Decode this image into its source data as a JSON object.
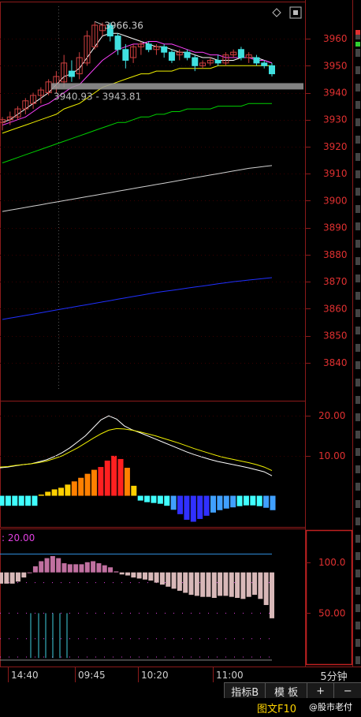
{
  "colors": {
    "background": "#000000",
    "frame": "#8b1a1a",
    "axis_text": "#e03030",
    "up_candle": "#d04040",
    "down_candle": "#40e0e0",
    "ma5": "#ffffff",
    "ma10": "#ff40ff",
    "ma20": "#f0f000",
    "ma30": "#00d000",
    "ma60": "#d0d0d0",
    "ma120": "#2030ff",
    "macd_dif": "#ffffff",
    "macd_dea": "#f0f000",
    "macd_hist_pos": [
      "#ff2020",
      "#ff8000",
      "#ffd000"
    ],
    "macd_hist_neg": [
      "#3030ff",
      "#40a0ff",
      "#40ffff"
    ],
    "osc_bar": "#d8b8b8",
    "osc_bar_up": "#c070a0",
    "osc_ref_line": "#3090e0",
    "osc_spike": "#40d0e0",
    "zone_band": "#999999"
  },
  "chart_data": [
    {
      "panel": "main",
      "type": "candlestick",
      "ylim": [
        3830,
        3972
      ],
      "y_ticks": [
        "3960",
        "3950",
        "3940",
        "3930",
        "3920",
        "3910",
        "3900",
        "3890",
        "3880",
        "3870",
        "3860",
        "3850",
        "3840"
      ],
      "high_label": "3966.36",
      "zone_label": "3940.93 - 3943.81",
      "zone": [
        3940.93,
        3943.81
      ],
      "candles": [
        {
          "o": 3929,
          "h": 3931,
          "l": 3926,
          "c": 3930
        },
        {
          "o": 3930,
          "h": 3933,
          "l": 3928,
          "c": 3931
        },
        {
          "o": 3931,
          "h": 3935,
          "l": 3930,
          "c": 3934
        },
        {
          "o": 3934,
          "h": 3938,
          "l": 3932,
          "c": 3937
        },
        {
          "o": 3936,
          "h": 3940,
          "l": 3934,
          "c": 3939
        },
        {
          "o": 3939,
          "h": 3942,
          "l": 3936,
          "c": 3941
        },
        {
          "o": 3940,
          "h": 3945,
          "l": 3939,
          "c": 3944
        },
        {
          "o": 3942,
          "h": 3948,
          "l": 3940,
          "c": 3946
        },
        {
          "o": 3944,
          "h": 3954,
          "l": 3942,
          "c": 3951
        },
        {
          "o": 3948,
          "h": 3952,
          "l": 3944,
          "c": 3946
        },
        {
          "o": 3947,
          "h": 3955,
          "l": 3945,
          "c": 3953
        },
        {
          "o": 3951,
          "h": 3963,
          "l": 3950,
          "c": 3961
        },
        {
          "o": 3957,
          "h": 3966.36,
          "l": 3956,
          "c": 3965
        },
        {
          "o": 3963,
          "h": 3966,
          "l": 3961,
          "c": 3965
        },
        {
          "o": 3965,
          "h": 3966,
          "l": 3959,
          "c": 3961
        },
        {
          "o": 3961,
          "h": 3962,
          "l": 3954,
          "c": 3956
        },
        {
          "o": 3956,
          "h": 3958,
          "l": 3949,
          "c": 3952
        },
        {
          "o": 3953,
          "h": 3958,
          "l": 3951,
          "c": 3957
        },
        {
          "o": 3957,
          "h": 3959,
          "l": 3954,
          "c": 3958
        },
        {
          "o": 3958,
          "h": 3959,
          "l": 3955,
          "c": 3956
        },
        {
          "o": 3956,
          "h": 3958,
          "l": 3954,
          "c": 3957
        },
        {
          "o": 3957,
          "h": 3958,
          "l": 3953,
          "c": 3955
        },
        {
          "o": 3955,
          "h": 3956,
          "l": 3951,
          "c": 3952
        },
        {
          "o": 3954,
          "h": 3956,
          "l": 3952,
          "c": 3955
        },
        {
          "o": 3955,
          "h": 3956,
          "l": 3952,
          "c": 3953
        },
        {
          "o": 3953,
          "h": 3954,
          "l": 3948,
          "c": 3950
        },
        {
          "o": 3950,
          "h": 3952,
          "l": 3949,
          "c": 3951
        },
        {
          "o": 3951,
          "h": 3953,
          "l": 3950,
          "c": 3952
        },
        {
          "o": 3952,
          "h": 3954,
          "l": 3950,
          "c": 3951
        },
        {
          "o": 3951,
          "h": 3955,
          "l": 3950,
          "c": 3954
        },
        {
          "o": 3954,
          "h": 3956,
          "l": 3953,
          "c": 3955
        },
        {
          "o": 3956,
          "h": 3957,
          "l": 3952,
          "c": 3953
        },
        {
          "o": 3953,
          "h": 3955,
          "l": 3951,
          "c": 3954
        },
        {
          "o": 3953,
          "h": 3954,
          "l": 3950,
          "c": 3951
        },
        {
          "o": 3951,
          "h": 3952,
          "l": 3949,
          "c": 3950
        },
        {
          "o": 3950,
          "h": 3951,
          "l": 3946,
          "c": 3947
        }
      ],
      "series": [
        {
          "key": "ma5",
          "values": [
            3929,
            3930,
            3932,
            3934,
            3936,
            3938,
            3940,
            3943,
            3946,
            3947,
            3949,
            3953,
            3957,
            3961,
            3962,
            3962,
            3961,
            3960,
            3959,
            3958,
            3957,
            3957,
            3956,
            3955,
            3955,
            3954,
            3953,
            3953,
            3952,
            3952,
            3952,
            3953,
            3953,
            3953,
            3952,
            3951
          ]
        },
        {
          "key": "ma10",
          "values": [
            3928,
            3929,
            3930,
            3931,
            3933,
            3935,
            3936,
            3938,
            3940,
            3942,
            3943,
            3946,
            3949,
            3952,
            3954,
            3956,
            3957,
            3958,
            3958,
            3959,
            3959,
            3958,
            3958,
            3957,
            3956,
            3955,
            3955,
            3954,
            3954,
            3953,
            3953,
            3953,
            3953,
            3952,
            3952,
            3951
          ]
        },
        {
          "key": "ma20",
          "values": [
            3925,
            3926,
            3927,
            3928,
            3929,
            3930,
            3931,
            3932,
            3934,
            3935,
            3936,
            3938,
            3940,
            3942,
            3943,
            3944,
            3945,
            3946,
            3947,
            3947,
            3948,
            3948,
            3948,
            3949,
            3949,
            3949,
            3949,
            3949,
            3950,
            3950,
            3950,
            3950,
            3950,
            3950,
            3950,
            3950
          ]
        },
        {
          "key": "ma30",
          "values": [
            3914,
            3915,
            3916,
            3917,
            3918,
            3919,
            3920,
            3921,
            3922,
            3923,
            3924,
            3925,
            3926,
            3927,
            3928,
            3929,
            3929,
            3930,
            3931,
            3931,
            3932,
            3932,
            3933,
            3933,
            3934,
            3934,
            3934,
            3934,
            3935,
            3935,
            3935,
            3935,
            3936,
            3936,
            3936,
            3936
          ]
        },
        {
          "key": "ma60",
          "values": [
            3896,
            3896.5,
            3897,
            3897.5,
            3898,
            3898.5,
            3899,
            3899.5,
            3900,
            3900.5,
            3901,
            3901.5,
            3902,
            3902.5,
            3903,
            3903.5,
            3904,
            3904.5,
            3905,
            3905.5,
            3906,
            3906.5,
            3907,
            3907.5,
            3908,
            3908.5,
            3909,
            3909.5,
            3910,
            3910.5,
            3911,
            3911.5,
            3912,
            3912.3,
            3912.7,
            3913
          ]
        },
        {
          "key": "ma120",
          "values": [
            3856,
            3856.5,
            3857,
            3857.5,
            3858,
            3858.5,
            3859,
            3859.5,
            3860,
            3860.5,
            3861,
            3861.5,
            3862,
            3862.5,
            3863,
            3863.5,
            3864,
            3864.5,
            3865,
            3865.5,
            3866,
            3866.4,
            3866.8,
            3867.2,
            3867.6,
            3868,
            3868.4,
            3868.8,
            3869.2,
            3869.6,
            3870,
            3870.3,
            3870.6,
            3870.9,
            3871.2,
            3871.5
          ]
        }
      ]
    },
    {
      "panel": "macd",
      "type": "bar",
      "ylim": [
        -7,
        23
      ],
      "y_ticks": [
        "20.00",
        "10.00"
      ],
      "histogram": [
        -2.5,
        -2.5,
        -2.5,
        -2.5,
        -2.5,
        -2.5,
        0.3,
        1.0,
        1.6,
        2.0,
        2.8,
        3.6,
        4.5,
        5.5,
        6.5,
        7.2,
        8.8,
        10,
        9.2,
        7,
        2.5,
        -1.2,
        -1.6,
        -1.8,
        -2.0,
        -2.5,
        -3.5,
        -4.6,
        -6.0,
        -6.5,
        -5.8,
        -5.0,
        -4.2,
        -3.6,
        -3.2,
        -2.9,
        -2.6,
        -2.4,
        -2.4,
        -2.6,
        -3.0,
        -3.6
      ],
      "series": [
        {
          "key": "dif",
          "values": [
            7,
            7.2,
            7.5,
            7.8,
            8,
            8.5,
            9,
            9.8,
            10.8,
            12,
            13.5,
            15,
            17,
            19,
            20,
            19.2,
            17.5,
            16.5,
            15.8,
            15,
            14.2,
            13.4,
            12.6,
            11.8,
            11,
            10.3,
            9.7,
            9.1,
            8.6,
            8.2,
            7.8,
            7.4,
            7,
            6.5,
            6,
            5
          ]
        },
        {
          "key": "dea",
          "values": [
            7.2,
            7.3,
            7.6,
            7.8,
            8,
            8.3,
            8.7,
            9.3,
            10,
            11,
            12,
            13.2,
            14.4,
            15.5,
            16.4,
            16.8,
            16.7,
            16.4,
            16,
            15.5,
            15,
            14.4,
            13.8,
            13.2,
            12.5,
            11.8,
            11.2,
            10.6,
            10,
            9.5,
            9.1,
            8.7,
            8.3,
            7.8,
            7.2,
            6.3
          ]
        }
      ]
    },
    {
      "panel": "oscillator",
      "type": "bar",
      "header": ": 20.00",
      "ylim": [
        0,
        130
      ],
      "y_ticks": [
        "100.0",
        "50.00"
      ],
      "ref_line": 108,
      "bars": [
        79,
        79,
        79,
        81,
        85,
        90,
        96,
        101,
        104,
        106,
        104,
        99,
        98,
        98,
        98,
        100,
        101,
        99,
        97,
        95,
        91,
        88,
        87,
        85,
        84,
        83,
        82,
        80,
        78,
        76,
        74,
        72,
        70,
        68,
        67,
        66,
        66,
        65,
        67,
        67,
        66,
        65,
        64,
        66,
        68,
        64,
        58,
        45
      ]
    }
  ],
  "x_axis": {
    "labels": [
      "14:40",
      "09:45",
      "10:20",
      "11:00"
    ]
  },
  "period_label": "5分钟",
  "toolbar": {
    "buttons": [
      "指标B",
      "模 板",
      "+",
      "−"
    ]
  },
  "footer": {
    "link": "图文F10",
    "watermark": "@股市老付"
  }
}
